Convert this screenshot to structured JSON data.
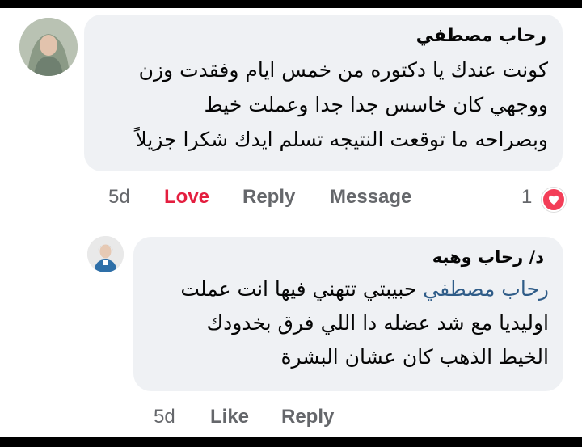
{
  "comment": {
    "author": "رحاب مصطفي",
    "lines": [
      "كونت عندك يا دكتوره من خمس ايام وفقدت وزن",
      "ووجهي كان خاسس جدا جدا وعملت خيط",
      "وبصراحه ما توقعت النتيجه تسلم ايدك شكرا جزيلاً"
    ],
    "actions": {
      "time": "5d",
      "love": "Love",
      "reply": "Reply",
      "message": "Message"
    },
    "reaction": {
      "count": "1",
      "icon": "heart-icon",
      "color": "#f33e58"
    }
  },
  "reply": {
    "author": "د/ رحاب وهبه",
    "mention": "رحاب مصطفي",
    "line1_rest": "حبيبتي تتهني فيها انت عملت",
    "line2": "اوليديا مع شد عضله دا اللي فرق بخدودك",
    "line3": "الخيط الذهب كان عشان البشرة",
    "actions": {
      "time": "5d",
      "like": "Like",
      "reply": "Reply"
    }
  },
  "colors": {
    "bubble": "#eff1f4",
    "text": "#050505",
    "secondary": "#65676b",
    "love": "#e41e3f",
    "mention": "#2f5c88"
  }
}
